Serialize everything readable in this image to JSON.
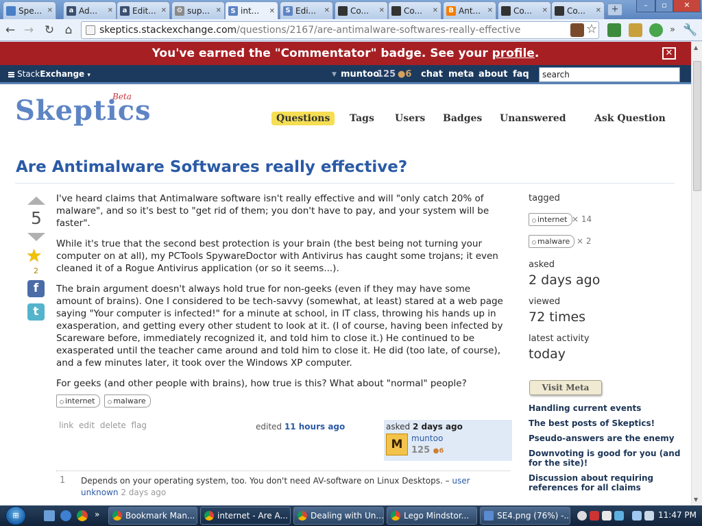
{
  "browser": {
    "tabs": [
      {
        "title": "Spe...",
        "icon": "google-spreadsheet-icon",
        "color": "#4a7fc6",
        "letter": ""
      },
      {
        "title": "Ad...",
        "icon": "amazon-icon",
        "color": "#3a4f70",
        "letter": "a"
      },
      {
        "title": "Edit...",
        "icon": "amazon-icon",
        "color": "#3a4f70",
        "letter": "a"
      },
      {
        "title": "sup...",
        "icon": "gear-icon",
        "color": "#8a8a8a",
        "letter": "⚙"
      },
      {
        "title": "int...",
        "icon": "skeptics-icon",
        "color": "#5d84c4",
        "letter": "S"
      },
      {
        "title": "Edi...",
        "icon": "skeptics-icon",
        "color": "#5d84c4",
        "letter": "S"
      },
      {
        "title": "Co...",
        "icon": "avatar-icon",
        "color": "#333333",
        "letter": ""
      },
      {
        "title": "Co...",
        "icon": "avatar-icon",
        "color": "#333333",
        "letter": ""
      },
      {
        "title": "Ant...",
        "icon": "blogger-icon",
        "color": "#f57d00",
        "letter": "B"
      },
      {
        "title": "Co...",
        "icon": "avatar-icon",
        "color": "#333333",
        "letter": ""
      },
      {
        "title": "Co...",
        "icon": "avatar-icon",
        "color": "#333333",
        "letter": ""
      }
    ],
    "new_tab": "+",
    "url_domain": "skeptics.stackexchange.com",
    "url_path": "/questions/2167/are-antimalware-softwares-really-effective",
    "window_min": "–",
    "window_max": "▫",
    "window_close": "✕"
  },
  "notify": {
    "text_before": "You've earned the \"Commentator\" badge. See your ",
    "link": "profile",
    "text_after": ".",
    "close": "✕"
  },
  "sebar": {
    "logo_plain": "Stack",
    "logo_bold": "Exchange",
    "logo_caret": "▾",
    "user": "muntoo",
    "rep": "125",
    "bronze": "●6",
    "links": [
      "chat",
      "meta",
      "about",
      "faq"
    ],
    "search": "search"
  },
  "site": {
    "name": "Skeptics",
    "beta": "Beta",
    "nav": [
      "Questions",
      "Tags",
      "Users",
      "Badges",
      "Unanswered",
      "Ask Question"
    ]
  },
  "question": {
    "title": "Are Antimalware Softwares really effective?",
    "votes": "5",
    "favorites": "2",
    "paragraphs": [
      "I've heard claims that Antimalware software isn't really effective and will \"only catch 20% of malware\", and so it's best to \"get rid of them; you don't have to pay, and your system will be faster\".",
      "While it's true that the second best protection is your brain (the best being not turning your computer on at all), my PCTools SpywareDoctor with Antivirus has caught some trojans; it even cleaned it of a Rogue Antivirus application (or so it seems...).",
      "The brain argument doesn't always hold true for non-geeks (even if they may have some amount of brains). One I considered to be tech-savvy (somewhat, at least) stared at a web page saying \"Your computer is infected!\" for a minute at school, in IT class, throwing his hands up in exasperation, and getting every other student to look at it. (I of course, having been infected by Scareware before, immediately recognized it, and told him to close it.) He continued to be exasperated until the teacher came around and told him to close it. He did (too late, of course), and a few minutes later, it took over the Windows XP computer.",
      "For geeks (and other people with brains), how true is this? What about \"normal\" people?"
    ],
    "tags": [
      "internet",
      "malware"
    ],
    "menu": "link edit delete flag",
    "edited_label": "edited",
    "edited_time": "11 hours ago",
    "asked_label": "asked",
    "asked_time": "2 days ago",
    "owner_name": "muntoo",
    "owner_rep": "125",
    "owner_bronze": "●6",
    "avatar_letter": "M"
  },
  "comment": {
    "score": "1",
    "text": "Depends on your operating system, too. You don't need AV-software on Linux Desktops. –",
    "user": "user unknown",
    "date": "2 days ago"
  },
  "sidebar": {
    "tagged_label": "tagged",
    "tags": [
      {
        "name": "internet",
        "count": "× 14"
      },
      {
        "name": "malware",
        "count": "× 2"
      }
    ],
    "asked_label": "asked",
    "asked_value": "2 days ago",
    "viewed_label": "viewed",
    "viewed_value": "72 times",
    "activity_label": "latest activity",
    "activity_value": "today",
    "visit_meta": "Visit Meta",
    "meta_links": [
      "Handling current events",
      "The best posts of Skeptics!",
      "Pseudo-answers are the enemy",
      "Downvoting is good for you (and for the site)!",
      "Discussion about requiring references for all claims"
    ]
  },
  "taskbar": {
    "overflow": "»",
    "tasks": [
      {
        "title": "Bookmark Man...",
        "active": false
      },
      {
        "title": "internet - Are A...",
        "active": true
      },
      {
        "title": "Dealing with Un...",
        "active": false
      },
      {
        "title": "Lego Mindstor...",
        "active": false
      },
      {
        "title": "SE4.png (76%) -...",
        "active": false
      }
    ],
    "clock": "11:47 PM"
  },
  "colors": {
    "notify_bg": "#a61f23",
    "sebar_bg": "#1c3a5e",
    "link_blue": "#2a5aa6",
    "nav_highlight": "#f5de52"
  }
}
